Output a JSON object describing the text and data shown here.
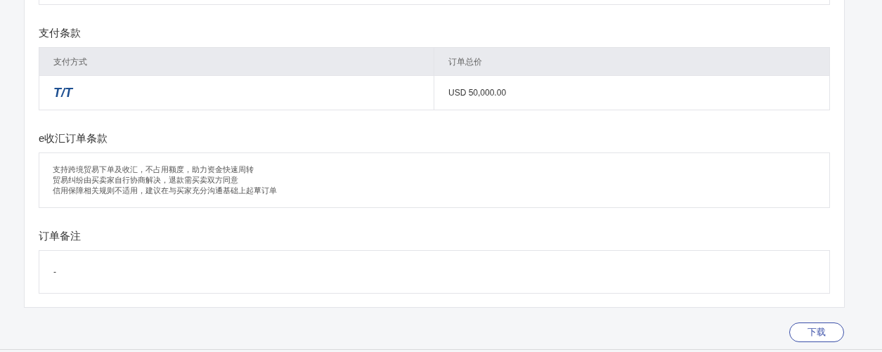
{
  "payment_terms": {
    "title": "支付条款",
    "columns": [
      "支付方式",
      "订单总价"
    ],
    "rows": [
      {
        "method": "T/T",
        "total": "USD 50,000.00"
      }
    ]
  },
  "e_terms": {
    "title": "e收汇订单条款",
    "lines": [
      "支持跨境贸易下单及收汇，不占用额度，助力资金快速周转",
      "贸易纠纷由买卖家自行协商解决，退款需买卖双方同意",
      "信用保障相关规则不适用，建议在与买家充分沟通基础上起草订单"
    ]
  },
  "remarks": {
    "title": "订单备注",
    "value": "-"
  },
  "download_button": "下载"
}
